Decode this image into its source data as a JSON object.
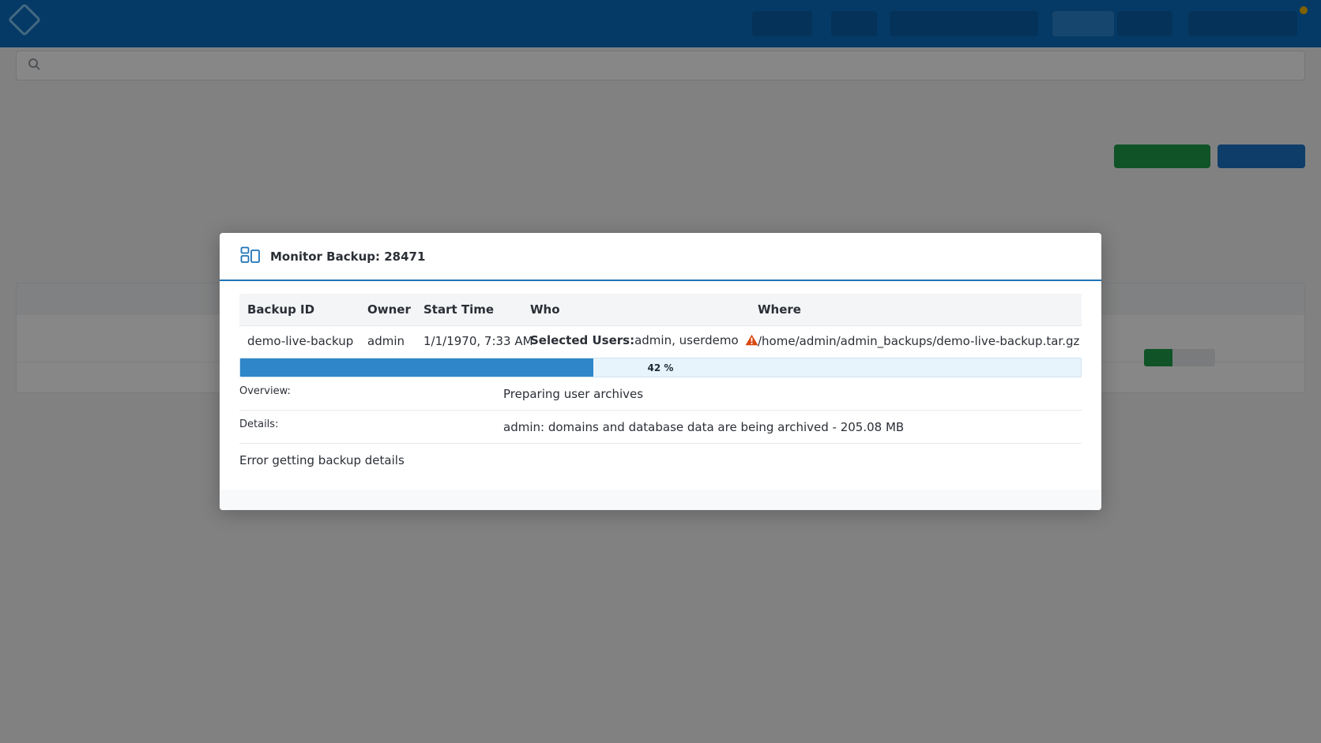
{
  "modal": {
    "title": "Monitor Backup: 28471",
    "columns": [
      "Backup ID",
      "Owner",
      "Start Time",
      "Who",
      "Where"
    ],
    "row": {
      "backup_id": "demo-live-backup",
      "owner": "admin",
      "start_time": "1/1/1970, 7:33 AM",
      "who_label": "Selected Users:",
      "who_value": "admin, userdemo",
      "where": "/home/admin/admin_backups/demo-live-backup.tar.gz"
    },
    "progress": {
      "value": 0.42,
      "label": "42 %"
    },
    "overview_label": "Overview:",
    "overview_value": "Preparing user archives",
    "details_label": "Details:",
    "details_value": "admin: domains and database data are being archived - 205.08 MB",
    "error_text": "Error getting backup details"
  },
  "colors": {
    "accent": "#1e74b8",
    "progress_fill": "#2f86c8",
    "warning": "#d9480f"
  },
  "icons": [
    "monitor-backup-icon",
    "warning-icon"
  ]
}
